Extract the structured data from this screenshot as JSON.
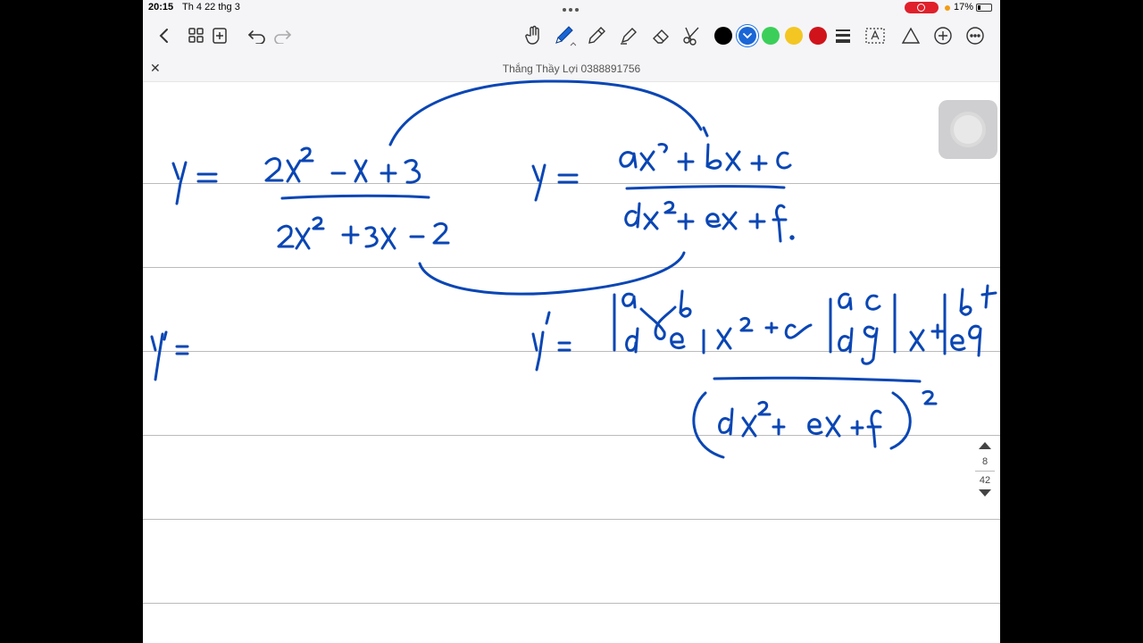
{
  "status": {
    "time": "20:15",
    "date": "Th 4 22 thg 3",
    "battery": "17%"
  },
  "toolbar": {
    "icons": [
      "back-icon",
      "grid-icon",
      "add-page-icon",
      "undo-icon",
      "redo-icon",
      "hand-icon",
      "pen-icon",
      "pencil-icon",
      "highlighter-icon",
      "eraser-icon",
      "lasso-icon"
    ],
    "colors": [
      "#000000",
      "#1a66d6",
      "#3bcf5a",
      "#f3c623",
      "#d0131b"
    ],
    "selected_color": "#1a66d6"
  },
  "document": {
    "title": "Thắng Thầy Lợi 0388891756"
  },
  "pager": {
    "current": "8",
    "total": "42"
  },
  "ink": {
    "color": "#0a46b4"
  }
}
